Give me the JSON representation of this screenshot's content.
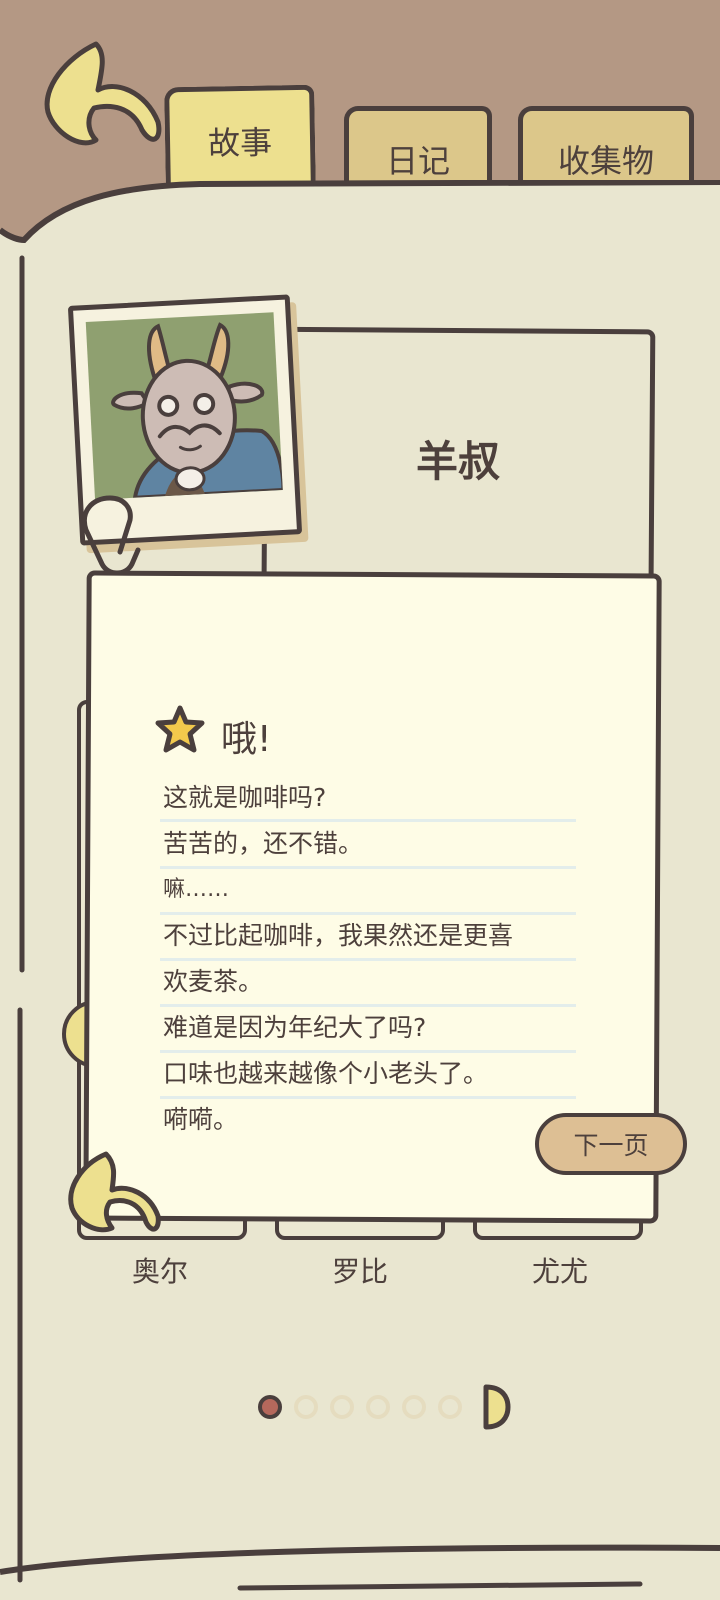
{
  "tabs": [
    {
      "label": "故事",
      "active": true
    },
    {
      "label": "日记",
      "active": false
    },
    {
      "label": "收集物",
      "active": false
    }
  ],
  "character": {
    "name": "羊叔"
  },
  "note": {
    "title": "哦!",
    "lines": [
      "这就是咖啡吗?",
      "苦苦的，还不错。",
      "嘛……",
      "不过比起咖啡，我果然还是更喜",
      "欢麦茶。",
      "难道是因为年纪大了吗?",
      "口味也越来越像个小老头了。",
      "嗬嗬。"
    ],
    "next_label": "下一页"
  },
  "book_labels": [
    "奥尔",
    "罗比",
    "尤尤"
  ],
  "pagination": {
    "total": 6,
    "current": 1
  },
  "colors": {
    "background": "#b49884",
    "page": "#e9e6d0",
    "note": "#fefce6",
    "outline": "#4a3f3d",
    "accent": "#ede08f",
    "star": "#f2c94c",
    "button": "#ddbf94"
  }
}
